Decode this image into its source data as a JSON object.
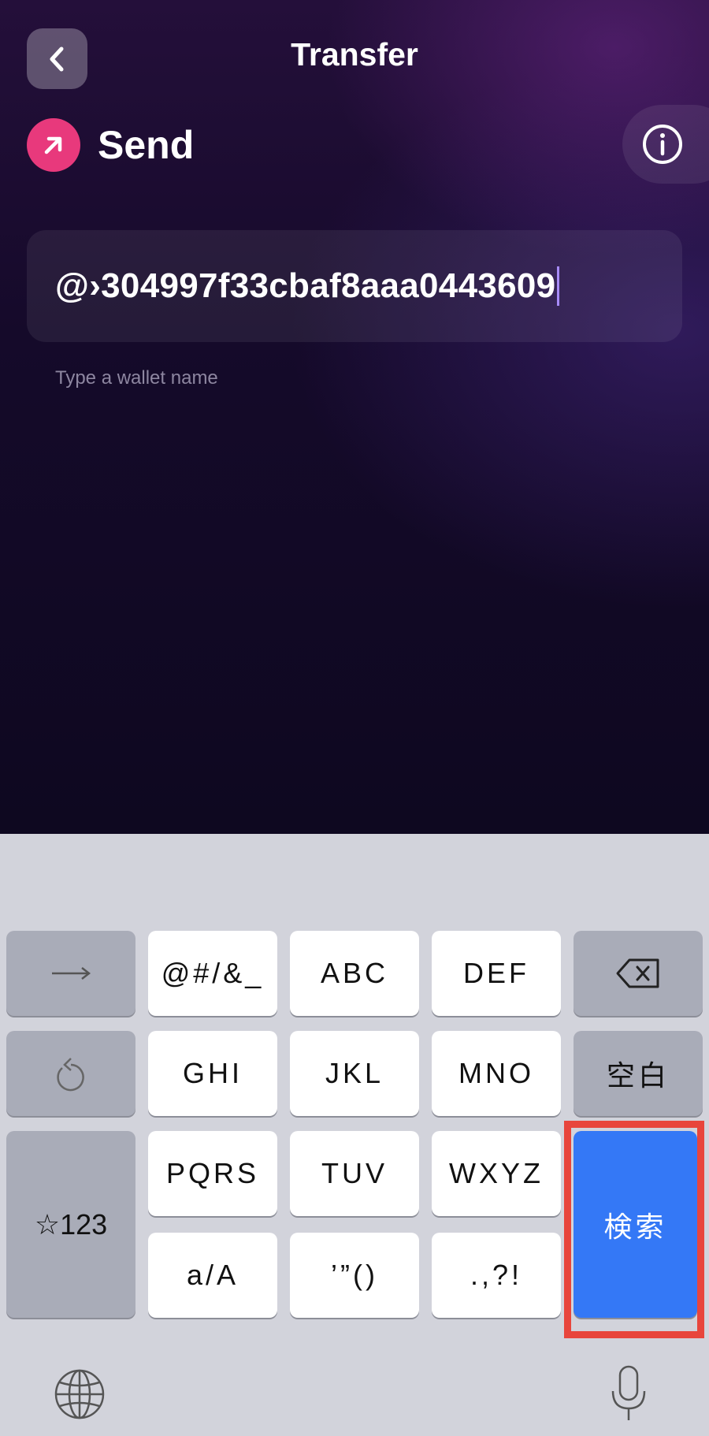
{
  "header": {
    "title": "Transfer",
    "back_icon": "chevron-left-icon"
  },
  "send": {
    "label": "Send",
    "icon": "arrow-up-right-icon",
    "icon_color": "#e8397c",
    "info_icon": "info-circle-icon"
  },
  "recipient_input": {
    "value": "@›304997f33cbaf8aaa0443609",
    "hint": "Type a wallet name"
  },
  "keyboard": {
    "row1": {
      "tab_icon": "arrow-right-icon",
      "k1": "@#/&_",
      "k2": "ABC",
      "k3": "DEF",
      "delete_icon": "backspace-icon"
    },
    "row2": {
      "undo_icon": "undo-icon",
      "k1": "GHI",
      "k2": "JKL",
      "k3": "MNO",
      "space": "空白"
    },
    "row3": {
      "symbols": "☆123",
      "k1": "PQRS",
      "k2": "TUV",
      "k3": "WXYZ",
      "search": "検索"
    },
    "row4": {
      "k1": "a/A",
      "k2": "’”()",
      "k3": ".,?!"
    },
    "globe_icon": "globe-icon",
    "mic_icon": "microphone-icon",
    "search_color": "#3478f6",
    "highlight_color": "#e8453c"
  }
}
